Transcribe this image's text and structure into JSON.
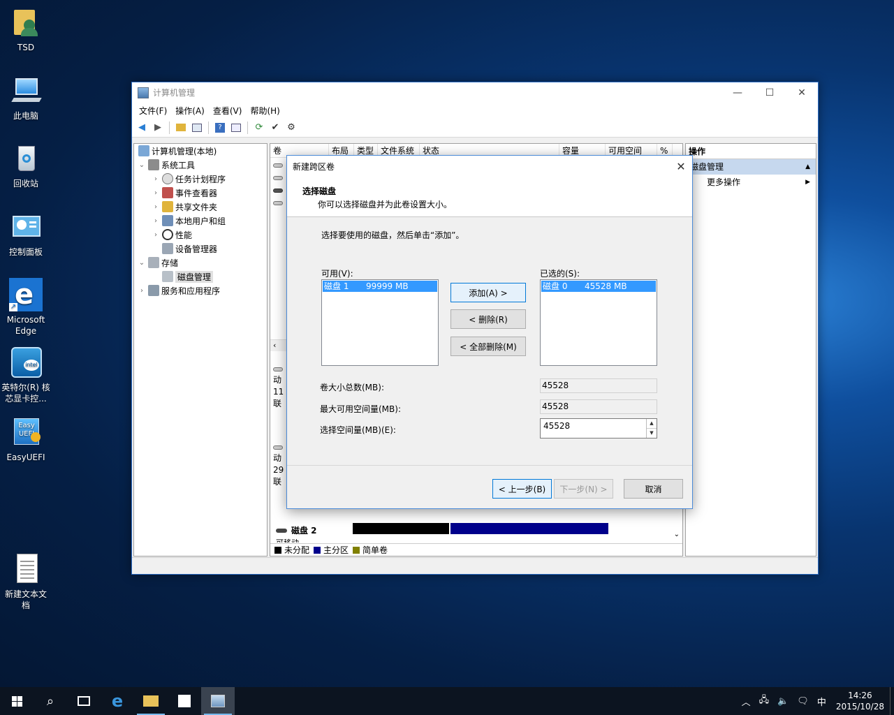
{
  "desktop": {
    "icons": [
      {
        "label": "TSD"
      },
      {
        "label": "此电脑"
      },
      {
        "label": "回收站"
      },
      {
        "label": "控制面板"
      },
      {
        "label": "Microsoft Edge"
      },
      {
        "label": "英特尔(R) 核芯显卡控..."
      },
      {
        "label": "EasyUEFI"
      },
      {
        "label": "新建文本文档"
      }
    ]
  },
  "window": {
    "title": "计算机管理",
    "menu": [
      "文件(F)",
      "操作(A)",
      "查看(V)",
      "帮助(H)"
    ],
    "tree": {
      "root": "计算机管理(本地)",
      "system_tools": "系统工具",
      "task_scheduler": "任务计划程序",
      "event_viewer": "事件查看器",
      "shared_folders": "共享文件夹",
      "local_users": "本地用户和组",
      "performance": "性能",
      "device_manager": "设备管理器",
      "storage": "存储",
      "disk_management": "磁盘管理",
      "services": "服务和应用程序"
    },
    "columns": [
      "卷",
      "布局",
      "类型",
      "文件系统",
      "状态",
      "容量",
      "可用空间",
      "%"
    ],
    "disk_rows": [
      {
        "line1": "动",
        "line2": "11",
        "line3": "联"
      },
      {
        "line1": "动",
        "line2": "29",
        "line3": "联"
      }
    ],
    "disk2": {
      "name": "磁盘 2",
      "sub": "可移动"
    },
    "legend": {
      "unallocated": "未分配",
      "primary": "主分区",
      "simple": "简单卷"
    },
    "actions": {
      "header": "操作",
      "section": "磁盘管理",
      "more": "更多操作"
    }
  },
  "dialog": {
    "title": "新建跨区卷",
    "heading": "选择磁盘",
    "subheading": "你可以选择磁盘并为此卷设置大小。",
    "instruction": "选择要使用的磁盘，然后单击“添加”。",
    "available_label": "可用(V):",
    "selected_label": "已选的(S):",
    "available": [
      {
        "name": "磁盘 1",
        "size": "99999 MB"
      }
    ],
    "selected": [
      {
        "name": "磁盘 0",
        "size": "45528 MB"
      }
    ],
    "add_button": "添加(A) >",
    "remove_button": "< 删除(R)",
    "remove_all_button": "< 全部删除(M)",
    "total_label": "卷大小总数(MB):",
    "total_value": "45528",
    "max_label": "最大可用空间量(MB):",
    "max_value": "45528",
    "select_label": "选择空间量(MB)(E):",
    "select_value": "45528",
    "back_button": "< 上一步(B)",
    "next_button": "下一步(N) >",
    "cancel_button": "取消"
  },
  "taskbar": {
    "ime": "中",
    "time": "14:26",
    "date": "2015/10/28"
  }
}
